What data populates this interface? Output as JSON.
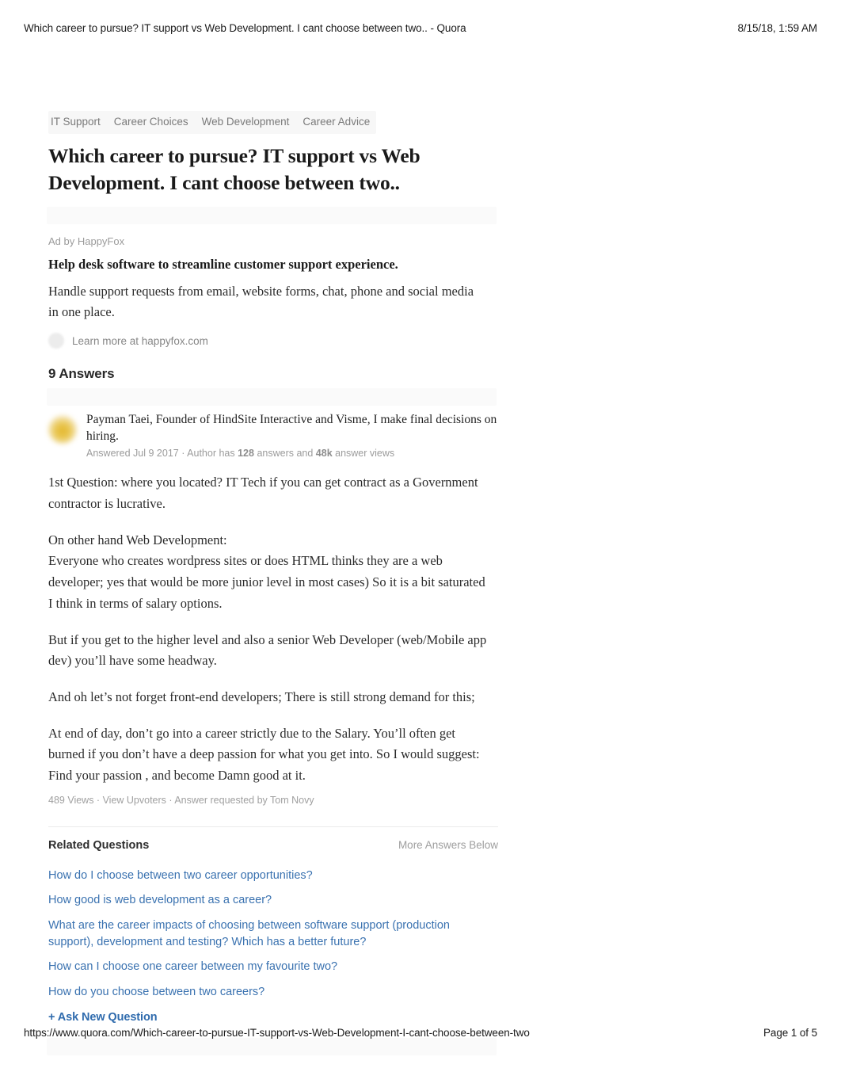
{
  "print_header": {
    "title": "Which career to pursue? IT support vs Web Development. I cant choose between two.. - Quora",
    "date": "8/15/18, 1:59 AM"
  },
  "print_footer": {
    "url": "https://www.quora.com/Which-career-to-pursue-IT-support-vs-Web-Development-I-cant-choose-between-two",
    "page": "Page 1 of 5"
  },
  "topics": [
    {
      "label": "IT Support"
    },
    {
      "label": "Career Choices"
    },
    {
      "label": "Web Development"
    },
    {
      "label": "Career Advice"
    }
  ],
  "question": {
    "title": "Which career to pursue? IT support vs Web Development. I cant choose between two.."
  },
  "ad": {
    "label": "Ad by HappyFox",
    "headline": "Help desk software to streamline customer support experience.",
    "body": "Handle support requests from email, website forms, chat, phone and social media in one place.",
    "cta": "Learn more at happyfox.com",
    "cta_icon": "avatar-placeholder-icon"
  },
  "answers_section": {
    "heading": "9 Answers"
  },
  "answer": {
    "avatar_icon": "user-avatar",
    "byline": "Payman Taei, Founder of HindSite Interactive and Visme, I make final decisions on hiring.",
    "meta": {
      "answered": "Answered Jul 9 2017",
      "separator": " · ",
      "author_has_prefix": "Author has ",
      "answers_count": "128",
      "answers_word": " answers and ",
      "views_count": "48k",
      "views_word": " answer views"
    },
    "paragraphs": [
      "1st Question: where you located? IT Tech if you can get contract as a Government contractor is lucrative.",
      "On other hand Web Development:\nEveryone who creates wordpress sites or does HTML thinks they are a web developer; yes that would be more junior level in most cases) So it is a bit saturated I think in terms of salary options.",
      "But if you get to the higher level and also a senior Web Developer (web/Mobile app dev) you’ll have some headway.",
      "And oh let’s not forget front-end developers; There is still strong demand for this;",
      "At end of day, don’t go into a career strictly due to the Salary. You’ll often get burned if you don’t have a deep passion for what you get into. So I would suggest: Find your passion , and become Damn good at it."
    ],
    "footer": {
      "views": "489 Views",
      "sep1": " · ",
      "upvoters": "View Upvoters",
      "sep2": " · ",
      "requested": "Answer requested by Tom Novy"
    }
  },
  "related": {
    "title": "Related Questions",
    "more_answers": "More Answers Below",
    "links": [
      {
        "label": "How do I choose between two career opportunities?"
      },
      {
        "label": "How good is web development as a career?"
      },
      {
        "label": "What are the career impacts of choosing between software support (production support), development and testing? Which has a better future?"
      },
      {
        "label": "How can I choose one career between my favourite two?"
      },
      {
        "label": "How do you choose between two careers?"
      }
    ],
    "ask_new": "+ Ask New Question"
  },
  "colors": {
    "link_blue": "#3a72b0",
    "ask_blue": "#2f6bad",
    "muted_gray": "#9b9b9b",
    "band_gray": "#fafafa",
    "avatar_gold": "#e3b62c"
  }
}
